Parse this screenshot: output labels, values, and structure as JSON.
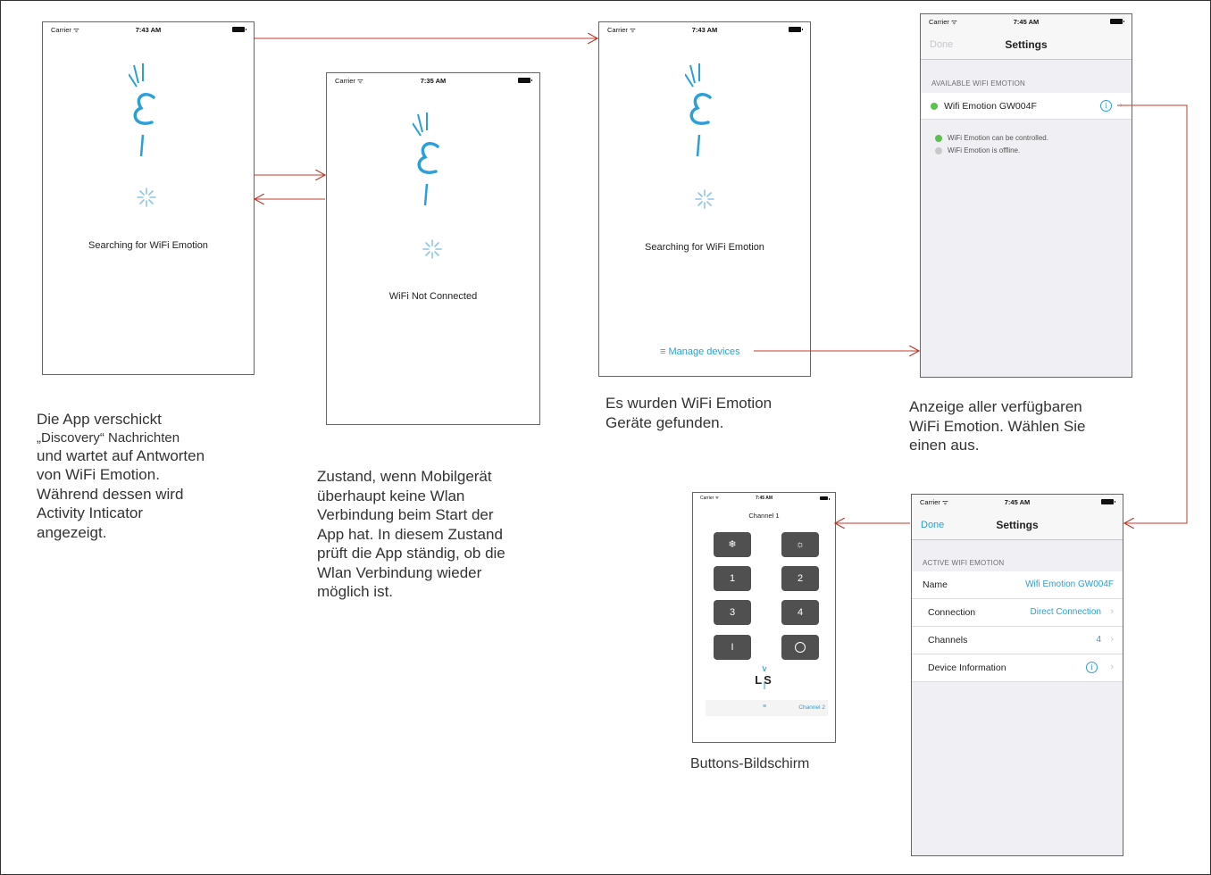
{
  "status_bar": {
    "carrier": "Carrier",
    "wifi_icon": "wifi-icon"
  },
  "screen1": {
    "time": "7:43 AM",
    "message": "Searching for WiFi Emotion",
    "caption_lines": [
      "Die App verschickt",
      "„Discovery“ Nachrichten",
      "und wartet auf Antworten",
      "von WiFi Emotion.",
      "Während dessen wird",
      "Activity Inticator",
      "angezeigt."
    ]
  },
  "screen2": {
    "time": "7:35 AM",
    "message": "WiFi Not Connected",
    "caption_lines": [
      "Zustand, wenn Mobilgerät",
      "überhaupt keine Wlan",
      "Verbindung beim Start der",
      "App hat. In diesem Zustand",
      "prüft die App ständig, ob die",
      "Wlan Verbindung wieder",
      "möglich ist."
    ]
  },
  "screen3": {
    "time": "7:43 AM",
    "message": "Searching for WiFi Emotion",
    "manage_link": "≡ Manage devices",
    "caption_lines": [
      "Es wurden WiFi Emotion",
      "Geräte gefunden."
    ]
  },
  "screen4": {
    "time": "7:45 AM",
    "nav_left": "Done",
    "nav_title": "Settings",
    "section_header": "AVAILABLE WIFI EMOTION",
    "device_name": "Wifi Emotion GW004F",
    "legend_online": "WiFi Emotion can be controlled.",
    "legend_offline": "WiFi Emotion is offline.",
    "online_color": "#5cc14d",
    "offline_color": "#c8c8c8",
    "caption_lines": [
      "Anzeige aller verfügbaren",
      "WiFi Emotion. Wählen Sie",
      "einen aus."
    ]
  },
  "screen5": {
    "time": "7:45 AM",
    "nav_left": "Done",
    "nav_title": "Settings",
    "section_header": "ACTIVE WIFI EMOTION",
    "rows": [
      {
        "label": "Name",
        "value": "Wifi Emotion GW004F"
      },
      {
        "label": "Connection",
        "value": "Direct Connection"
      },
      {
        "label": "Channels",
        "value": "4"
      },
      {
        "label": "Device Information",
        "value": ""
      }
    ]
  },
  "screen6": {
    "time": "7:45 AM",
    "title": "Channel 1",
    "keys": [
      "❄",
      "☼",
      "1",
      "2",
      "3",
      "4",
      "I",
      "O"
    ],
    "logo_text": "LS",
    "tab_icon": "≡",
    "tab_next": "Channel 2",
    "caption": "Buttons-Bildschirm"
  },
  "colors": {
    "accent": "#2a9fd8",
    "arrow": "#c0392b"
  }
}
